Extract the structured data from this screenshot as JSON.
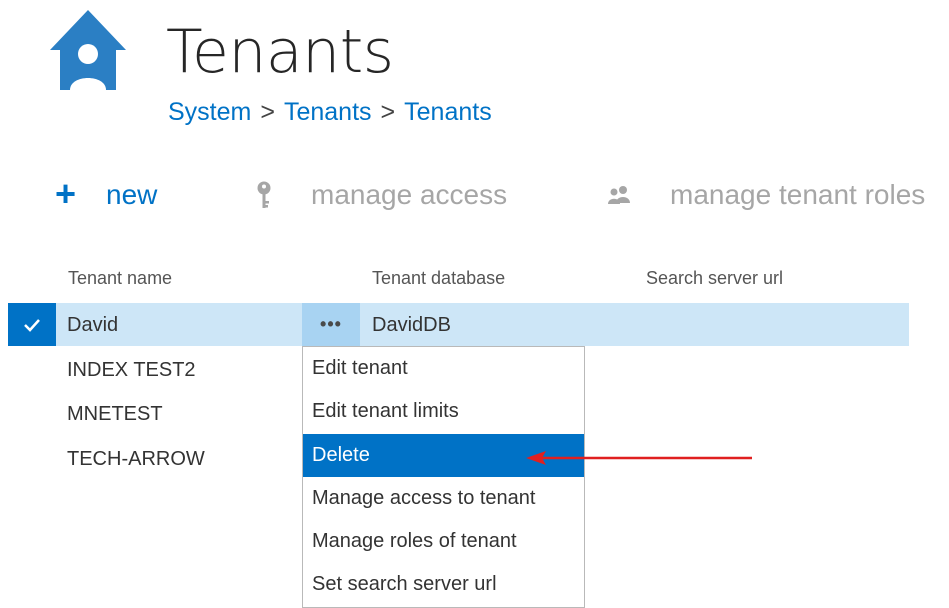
{
  "header": {
    "title": "Tenants",
    "breadcrumb": [
      "System",
      "Tenants",
      "Tenants"
    ],
    "breadcrumb_separator": ">"
  },
  "toolbar": {
    "new_label": "new",
    "new_icon": "plus-icon",
    "manage_access_label": "manage access",
    "manage_access_icon": "key-icon",
    "manage_roles_label": "manage tenant roles",
    "manage_roles_icon": "users-icon"
  },
  "table": {
    "columns": [
      "Tenant name",
      "Tenant database",
      "Search server url"
    ],
    "rows": [
      {
        "name": "David",
        "database": "DavidDB",
        "search_url": "",
        "selected": true
      },
      {
        "name": "INDEX TEST2",
        "database": "",
        "search_url": "",
        "selected": false
      },
      {
        "name": "MNETEST",
        "database": "",
        "search_url": "",
        "selected": false
      },
      {
        "name": "TECH-ARROW",
        "database": "",
        "search_url": "",
        "selected": false
      }
    ],
    "row_menu_label": "•••"
  },
  "context_menu": {
    "items": [
      {
        "label": "Edit tenant",
        "active": false
      },
      {
        "label": "Edit tenant limits",
        "active": false
      },
      {
        "label": "Delete",
        "active": true
      },
      {
        "label": "Manage access to tenant",
        "active": false
      },
      {
        "label": "Manage roles of tenant",
        "active": false
      },
      {
        "label": "Set search server url",
        "active": false
      }
    ]
  },
  "colors": {
    "accent": "#0072c6",
    "selected_row": "#cde6f7",
    "disabled": "#a6a6a6",
    "annotation_arrow": "#e02020"
  }
}
